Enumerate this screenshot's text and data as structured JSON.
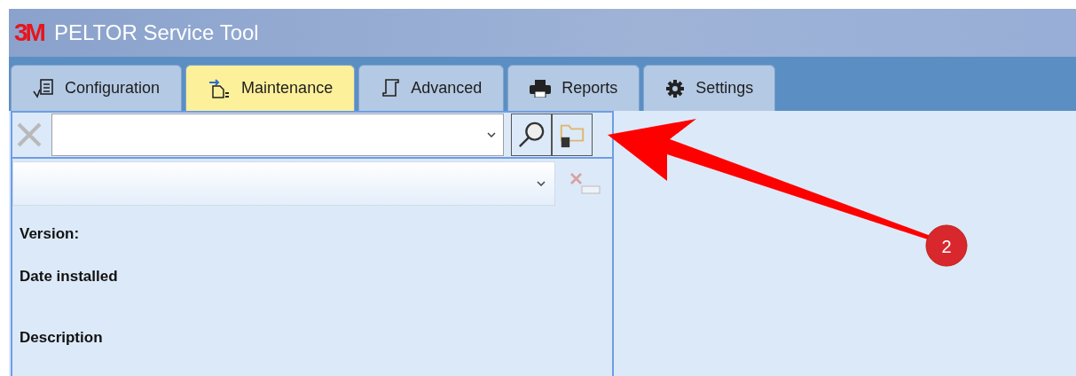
{
  "window": {
    "title": "PELTOR Service Tool",
    "logo": "3M"
  },
  "tabs": [
    {
      "label": "Configuration",
      "selected": false
    },
    {
      "label": "Maintenance",
      "selected": true
    },
    {
      "label": "Advanced",
      "selected": false
    },
    {
      "label": "Reports",
      "selected": false
    },
    {
      "label": "Settings",
      "selected": false
    }
  ],
  "fields": [
    {
      "label": "Version:"
    },
    {
      "label": "Date installed"
    },
    {
      "label": "Description"
    }
  ],
  "annotation": {
    "badge": "2"
  }
}
